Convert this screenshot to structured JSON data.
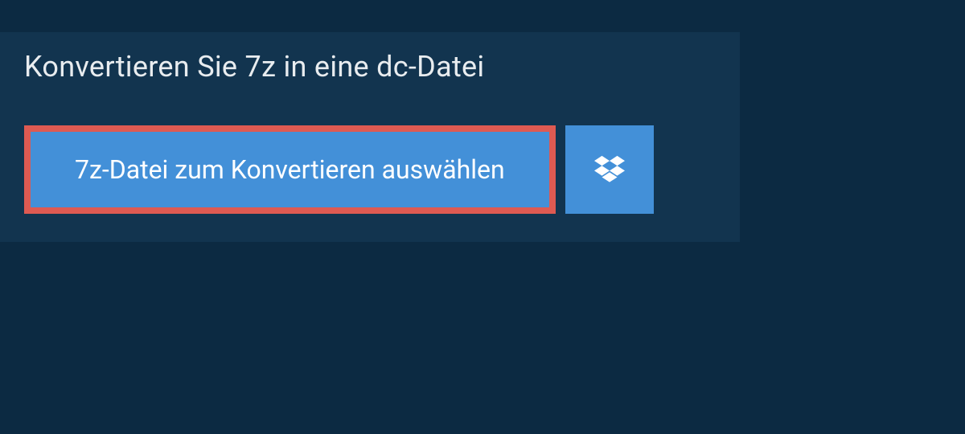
{
  "header": {
    "title": "Konvertieren Sie 7z in eine dc-Datei"
  },
  "actions": {
    "select_file_label": "7z-Datei zum Konvertieren auswählen",
    "dropbox_icon_name": "dropbox"
  },
  "colors": {
    "page_bg": "#0c2a42",
    "panel_bg": "#12344f",
    "button_bg": "#4390d8",
    "highlight_border": "#de5a52",
    "text_light": "#e8ecef",
    "text_white": "#ffffff"
  }
}
